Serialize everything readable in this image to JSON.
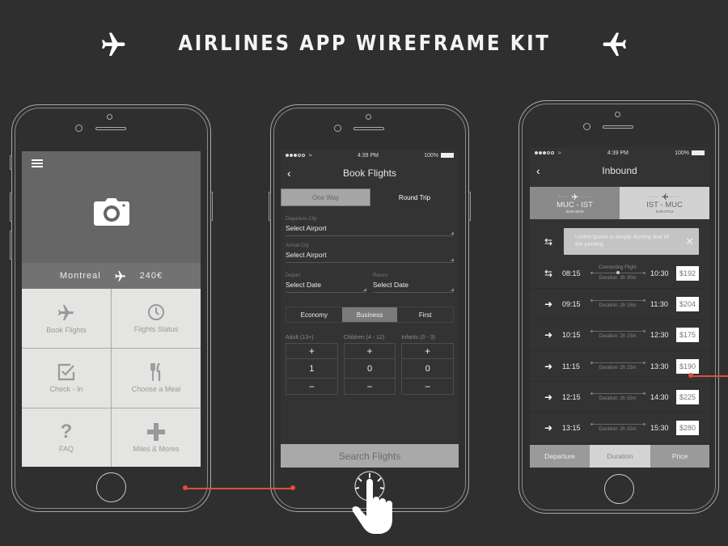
{
  "header": {
    "title": "AIRLINES APP WIREFRAME KIT",
    "left_icon": "airplane-icon",
    "right_icon": "airplane-icon"
  },
  "colors": {
    "background": "#2f2f2f",
    "accent_connector": "#e34b3c"
  },
  "home_screen": {
    "menu_icon": "hamburger-icon",
    "hero_icon": "camera-icon",
    "route": {
      "city": "Montreal",
      "price": "240€"
    },
    "tiles": [
      {
        "label": "Book Flights",
        "icon": "airplane-icon"
      },
      {
        "label": "Flights Status",
        "icon": "clock-icon"
      },
      {
        "label": "Check - In",
        "icon": "checkbox-icon"
      },
      {
        "label": "Choose a Meal",
        "icon": "cutlery-icon"
      },
      {
        "label": "FAQ",
        "icon": "question-icon"
      },
      {
        "label": "Miles & Mores",
        "icon": "plus-icon"
      }
    ]
  },
  "book_screen": {
    "status": {
      "time": "4:39 PM",
      "battery": "100%"
    },
    "title": "Book Flights",
    "trip_types": [
      "One Way",
      "Round Trip"
    ],
    "selected_trip_type": "One Way",
    "departure": {
      "label": "Departure City",
      "value": "Select Airport"
    },
    "arrival": {
      "label": "Arrival City",
      "value": "Select Airport"
    },
    "depart_date": {
      "label": "Depart",
      "value": "Select Date"
    },
    "return_date": {
      "label": "Return",
      "value": "Select Date"
    },
    "classes": [
      "Economy",
      "Business",
      "First"
    ],
    "selected_class": "Business",
    "passengers": [
      {
        "label": "Adult (13+)",
        "count": "1"
      },
      {
        "label": "Children (4 - 12)",
        "count": "0"
      },
      {
        "label": "Infants (0 - 3)",
        "count": "0"
      }
    ],
    "plus": "+",
    "minus": "−",
    "search_label": "Search Flights"
  },
  "inbound_screen": {
    "status": {
      "time": "4:39 PM",
      "battery": "100%"
    },
    "title": "Inbound",
    "legs": [
      {
        "route": "MUC - IST",
        "date": "SUN 05/18",
        "selected": true
      },
      {
        "route": "IST - MUC",
        "date": "SUN 07/12",
        "selected": false
      }
    ],
    "notice": "Lorem Ipsum is simply dummy text of the printing",
    "flights": [
      {
        "type": "connecting",
        "depart": "08:15",
        "arrive": "10:30",
        "note": "Connecting Flight",
        "duration": "Duration: 3h 30m",
        "price": "$192"
      },
      {
        "type": "direct",
        "depart": "09:15",
        "arrive": "11:30",
        "note": "",
        "duration": "Duration: 2h 15m",
        "price": "$204"
      },
      {
        "type": "direct",
        "depart": "10:15",
        "arrive": "12:30",
        "note": "",
        "duration": "Duration: 2h 15m",
        "price": "$175"
      },
      {
        "type": "direct",
        "depart": "11:15",
        "arrive": "13:30",
        "note": "",
        "duration": "Duration: 2h 15m",
        "price": "$190"
      },
      {
        "type": "direct",
        "depart": "12:15",
        "arrive": "14:30",
        "note": "",
        "duration": "Duration: 2h 15m",
        "price": "$225"
      },
      {
        "type": "direct",
        "depart": "13:15",
        "arrive": "15:30",
        "note": "",
        "duration": "Duration: 2h 15m",
        "price": "$280"
      }
    ],
    "sort_options": [
      "Departure",
      "Duration",
      "Price"
    ],
    "selected_sort": "Duration"
  }
}
